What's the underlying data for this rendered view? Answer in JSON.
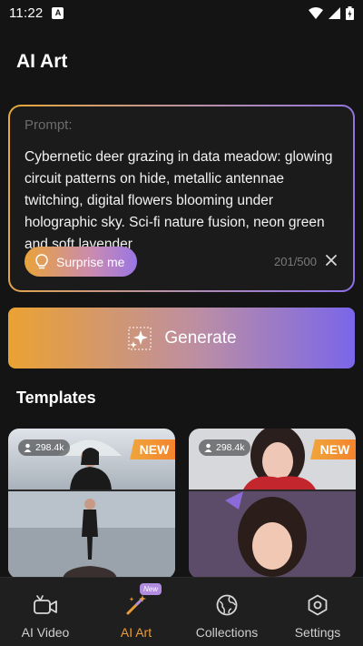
{
  "status": {
    "time": "11:22"
  },
  "page_title": "AI Art",
  "prompt": {
    "label": "Prompt:",
    "text": "Cybernetic deer grazing in data meadow: glowing circuit patterns on hide, metallic antennae twitching, digital flowers blooming under holographic sky. Sci-fi nature fusion, neon green and soft lavender",
    "surprise_label": "Surprise me",
    "char_count": "201/500"
  },
  "generate_label": "Generate",
  "templates": {
    "title": "Templates",
    "items": [
      {
        "usage": "298.4k",
        "badge": "NEW"
      },
      {
        "usage": "298.4k",
        "badge": "NEW"
      }
    ]
  },
  "nav": {
    "items": [
      {
        "label": "AI Video",
        "icon": "video-camera-icon"
      },
      {
        "label": "AI Art",
        "icon": "magic-wand-icon",
        "badge": "New",
        "active": true
      },
      {
        "label": "Collections",
        "icon": "globe-icon"
      },
      {
        "label": "Settings",
        "icon": "hexagon-gear-icon"
      }
    ]
  },
  "colors": {
    "background": "#141414",
    "accent_orange": "#e89d3a",
    "accent_purple": "#7a66ea"
  }
}
